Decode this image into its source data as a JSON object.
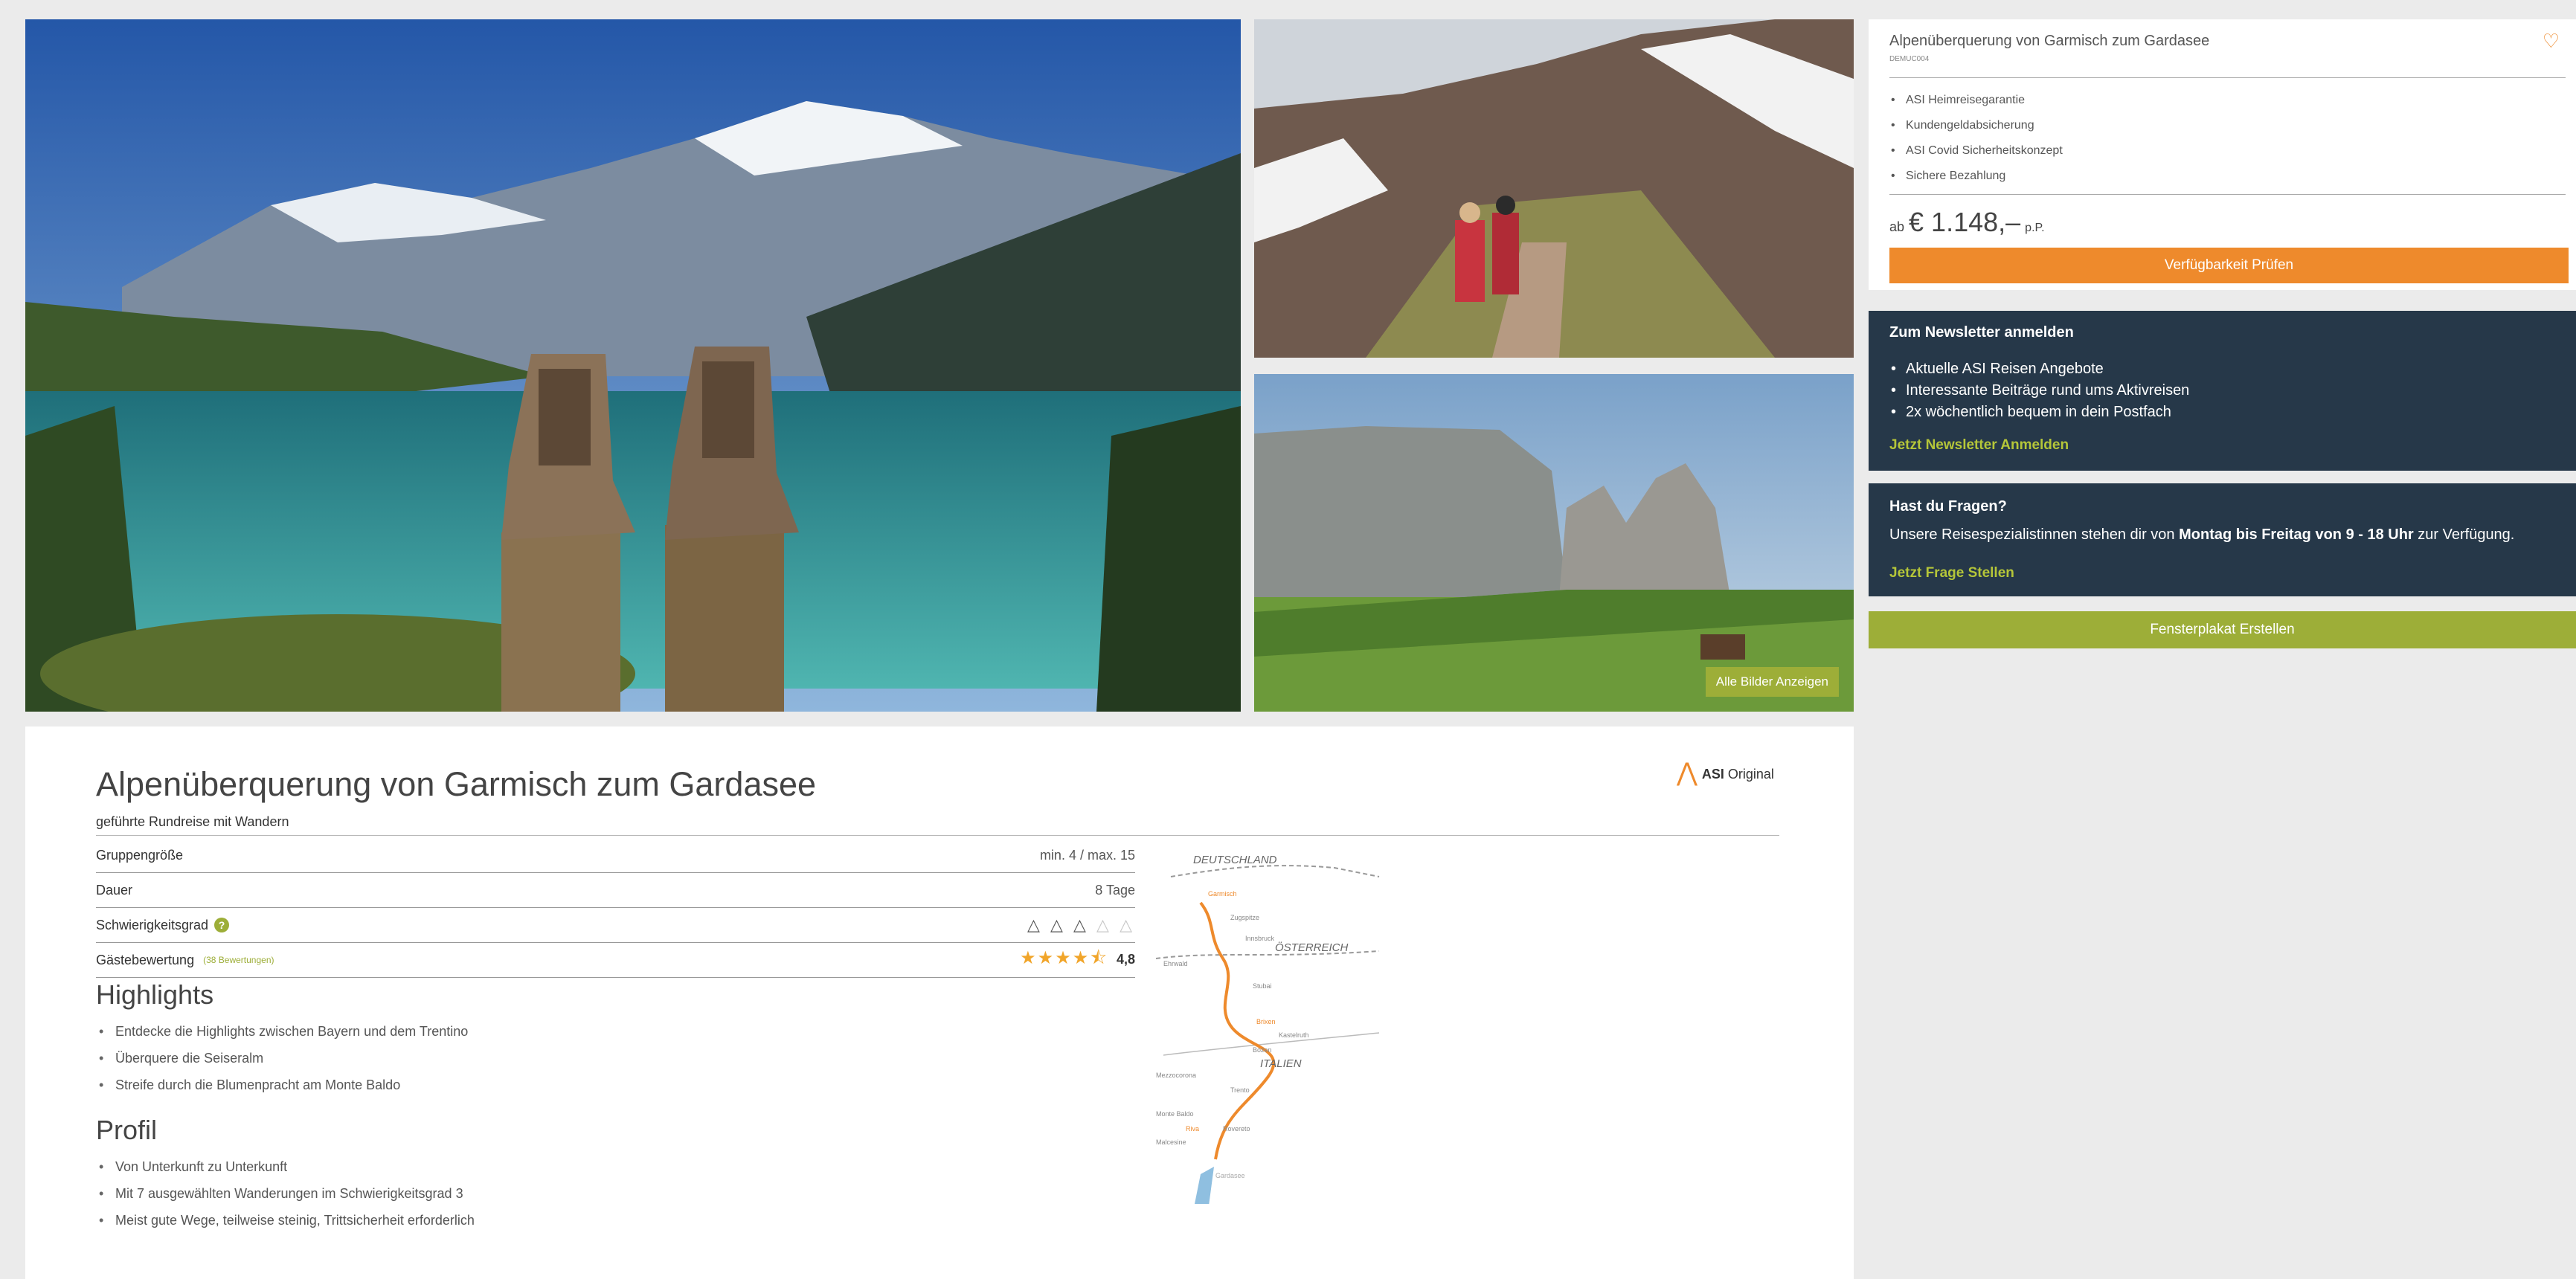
{
  "gallery": {
    "all_images_label": "Alle Bilder Anzeigen"
  },
  "tour": {
    "title": "Alpenüberquerung von Garmisch zum Gardasee",
    "subtitle": "geführte Rundreise mit Wandern",
    "brand": {
      "bold": "ASI",
      "rest": " Original"
    },
    "facts": [
      {
        "label": "Gruppengröße",
        "value": "min. 4 / max. 15"
      },
      {
        "label": "Dauer",
        "value": "8 Tage"
      },
      {
        "label": "Schwierigkeitsgrad",
        "value_filled": "△ △ △",
        "value_empty": " △ △",
        "difficulty": 3,
        "difficulty_max": 5
      },
      {
        "label": "Gästebewertung",
        "reviews": "(38 Bewertungen)",
        "rating": "4,8",
        "stars": "★★★★⯪"
      }
    ],
    "highlights_heading": "Highlights",
    "highlights": [
      "Entdecke die Highlights zwischen Bayern und dem Trentino",
      "Überquere die Seiseralm",
      "Streife durch die Blumenpracht am Monte Baldo"
    ],
    "profile_heading": "Profil",
    "profile": [
      "Von Unterkunft zu Unterkunft",
      "Mit 7 ausgewählten Wanderungen im Schwierigkeitsgrad 3",
      "Meist gute Wege, teilweise steinig, Trittsicherheit erforderlich"
    ],
    "map": {
      "countries": [
        "DEUTSCHLAND",
        "ÖSTERREICH",
        "ITALIEN"
      ],
      "places": [
        "Garmisch",
        "Zugspitze",
        "Innsbruck",
        "Ehrwald",
        "Stubai",
        "Brixen",
        "Kastelruth",
        "Bozen",
        "Mezzocorona",
        "Trento",
        "Monte Baldo",
        "Riva",
        "Rovereto",
        "Malcesine",
        "Gardasee"
      ]
    }
  },
  "booking": {
    "title": "Alpenüberquerung von Garmisch zum Gardasee",
    "code": "DEMUC004",
    "features": [
      "ASI Heimreisegarantie",
      "Kundengeldabsicherung",
      "ASI Covid Sicherheitskonzept",
      "Sichere Bezahlung"
    ],
    "price_prefix": "ab",
    "price": "€ 1.148,–",
    "price_suffix": "p.P.",
    "check_label": "Verfügbarkeit Prüfen"
  },
  "newsletter": {
    "heading": "Zum Newsletter anmelden",
    "items": [
      "Aktuelle ASI Reisen Angebote",
      "Interessante Beiträge rund ums Aktivreisen",
      "2x wöchentlich bequem in dein Postfach"
    ],
    "link": "Jetzt Newsletter Anmelden"
  },
  "questions": {
    "heading": "Hast du Fragen?",
    "text_start": "Unsere Reisespezialistinnen stehen dir von ",
    "text_bold": "Montag bis Freitag von 9 - 18 Uhr",
    "text_end": " zur Verfügung.",
    "link": "Jetzt Frage Stellen"
  },
  "poster_label": "Fensterplakat Erstellen",
  "colors": {
    "orange": "#ee8a2c",
    "green": "#9dae38",
    "navy": "#263849"
  }
}
